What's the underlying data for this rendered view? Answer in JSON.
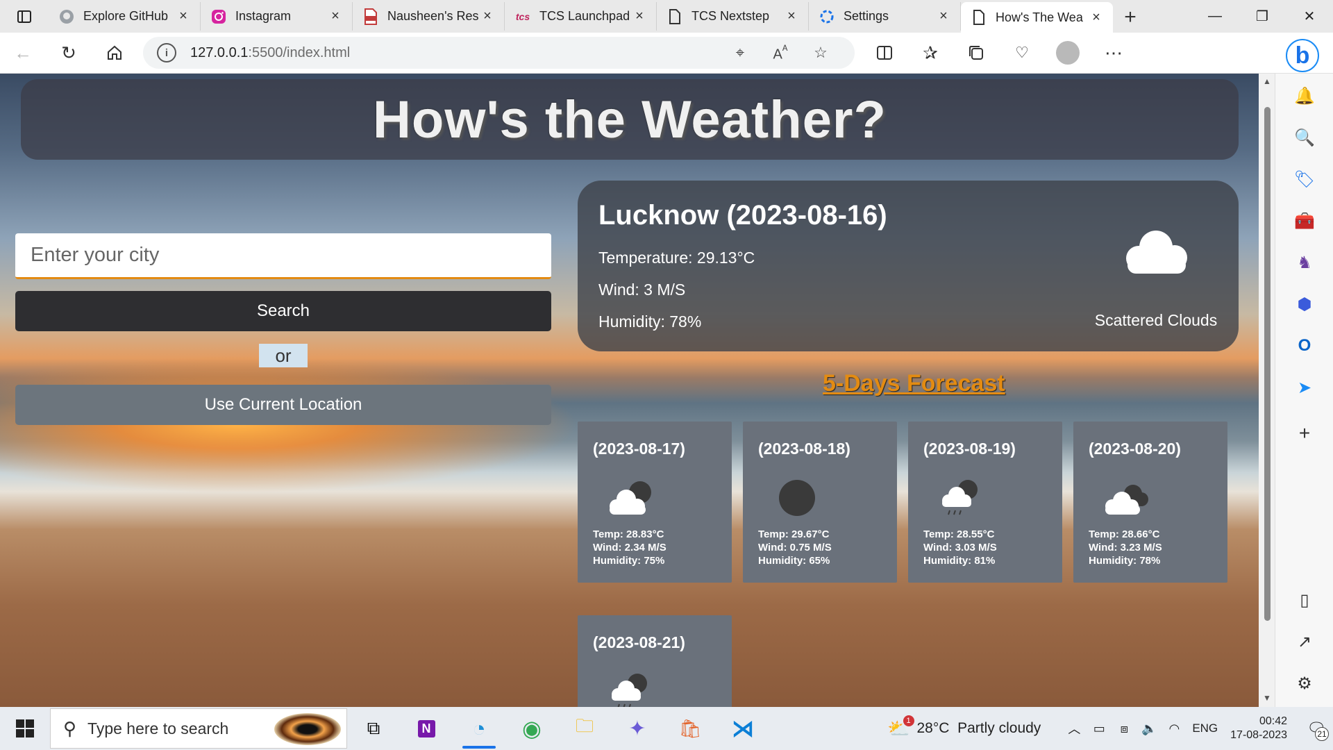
{
  "browser": {
    "tabs": [
      {
        "label": "Explore GitHub",
        "icon": "github-icon",
        "active": false
      },
      {
        "label": "Instagram",
        "icon": "instagram-icon",
        "active": false
      },
      {
        "label": "Nausheen's Res",
        "icon": "pdf-icon",
        "active": false
      },
      {
        "label": "TCS Launchpad",
        "icon": "tcs-icon",
        "active": false
      },
      {
        "label": "TCS Nextstep",
        "icon": "page-icon",
        "active": false
      },
      {
        "label": "Settings",
        "icon": "settings-icon",
        "active": false
      },
      {
        "label": "How's The Wea",
        "icon": "page-icon",
        "active": true
      }
    ],
    "url_host": "127.0.0.1",
    "url_rest": ":5500/index.html"
  },
  "page": {
    "title": "How's the Weather?",
    "search": {
      "placeholder": "Enter your city",
      "button": "Search"
    },
    "or_label": "or",
    "location_button": "Use Current Location",
    "current": {
      "heading": "Lucknow (2023-08-16)",
      "temperature": "Temperature: 29.13°C",
      "wind": "Wind: 3 M/S",
      "humidity": "Humidity: 78%",
      "description": "Scattered Clouds",
      "icon": "scattered-clouds-icon"
    },
    "forecast_title": "5-Days Forecast",
    "forecast": [
      {
        "date": "(2023-08-17)",
        "temp": "Temp: 28.83°C",
        "wind": "Wind: 2.34 M/S",
        "humidity": "Humidity: 75%",
        "icon": "cloud-night-icon"
      },
      {
        "date": "(2023-08-18)",
        "temp": "Temp: 29.67°C",
        "wind": "Wind: 0.75 M/S",
        "humidity": "Humidity: 65%",
        "icon": "clear-night-icon"
      },
      {
        "date": "(2023-08-19)",
        "temp": "Temp: 28.55°C",
        "wind": "Wind: 3.03 M/S",
        "humidity": "Humidity: 81%",
        "icon": "rain-night-icon"
      },
      {
        "date": "(2023-08-20)",
        "temp": "Temp: 28.66°C",
        "wind": "Wind: 3.23 M/S",
        "humidity": "Humidity: 78%",
        "icon": "broken-clouds-icon"
      },
      {
        "date": "(2023-08-21)",
        "temp": "",
        "wind": "",
        "humidity": "",
        "icon": "rain-night-icon"
      }
    ]
  },
  "taskbar": {
    "search_placeholder": "Type here to search",
    "weather": "28°C  Partly cloudy",
    "weather_badge": "1",
    "language": "ENG",
    "time": "00:42",
    "date": "17-08-2023",
    "notifications": "21"
  },
  "colors": {
    "accent": "#e38b12",
    "card": "#6a717b",
    "search_button": "#2e2e31",
    "location_button": "#6c757d"
  }
}
